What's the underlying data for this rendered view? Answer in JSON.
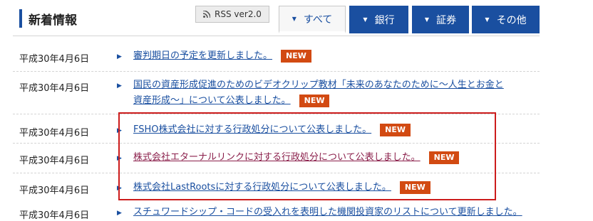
{
  "header": {
    "title": "新着情報",
    "rss_label": "RSS ver2.0",
    "tabs": [
      {
        "label": "すべて"
      },
      {
        "label": "銀行"
      },
      {
        "label": "証券"
      },
      {
        "label": "その他"
      }
    ]
  },
  "news": [
    {
      "date": "平成30年4月6日",
      "title": "審判期日の予定を更新しました。",
      "badge": "NEW",
      "visited": false
    },
    {
      "date": "平成30年4月6日",
      "title_line1": "国民の資産形成促進のためのビデオクリップ教材「未来のあなたのために～人生とお金と",
      "title_line2": "資産形成～」について公表しました。",
      "badge": "NEW",
      "visited": false
    },
    {
      "date": "平成30年4月6日",
      "title": "FSHO株式会社に対する行政処分について公表しました。",
      "badge": "NEW",
      "visited": false
    },
    {
      "date": "平成30年4月6日",
      "title": "株式会社エターナルリンクに対する行政処分について公表しました。",
      "badge": "NEW",
      "visited": true
    },
    {
      "date": "平成30年4月6日",
      "title": "株式会社LastRootsに対する行政処分について公表しました。",
      "badge": "NEW",
      "visited": false
    },
    {
      "date": "平成30年4月6日",
      "title": "スチュワードシップ・コードの受入れを表明した機関投資家のリストについて更新しました。",
      "badge": "",
      "visited": false
    }
  ],
  "colors": {
    "accent": "#1a4fa0",
    "badge": "#d24a12",
    "highlight": "#cc1c1c",
    "visited_link": "#8a1e4a"
  }
}
